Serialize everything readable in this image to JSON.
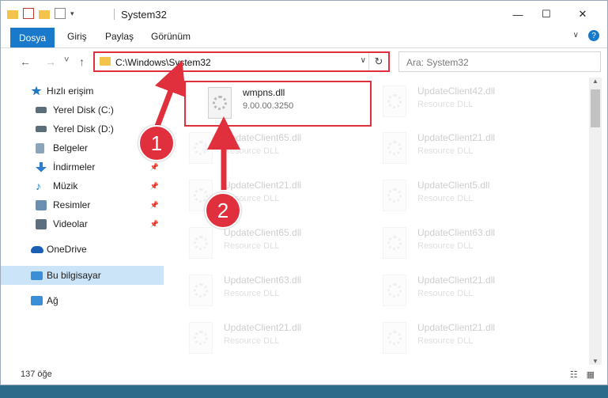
{
  "window": {
    "title": "System32",
    "minimize_glyph": "—",
    "maximize_glyph": "☐",
    "close_glyph": "✕"
  },
  "ribbon": {
    "tabs": [
      "Dosya",
      "Giriş",
      "Paylaş",
      "Görünüm"
    ]
  },
  "address_bar": {
    "path": "C:\\Windows\\System32",
    "refresh_glyph": "↻",
    "dropdown_glyph": "∨"
  },
  "search": {
    "placeholder": "Ara: System32"
  },
  "nav": {
    "back": "←",
    "forward": "→",
    "recent": "˅",
    "up": "↑"
  },
  "sidebar": {
    "items": [
      {
        "label": "Hızlı erişim",
        "icon": "star-icon",
        "color": "#1a78c2"
      },
      {
        "label": "Yerel Disk (C:)",
        "icon": "disk-icon",
        "color": "#5a6d7a"
      },
      {
        "label": "Yerel Disk (D:)",
        "icon": "disk-icon",
        "color": "#5a6d7a"
      },
      {
        "label": "Belgeler",
        "icon": "documents-icon",
        "color": "#8ca4ba"
      },
      {
        "label": "İndirmeler",
        "icon": "download-icon",
        "color": "#2f7fd0"
      },
      {
        "label": "Müzik",
        "icon": "music-icon",
        "color": "#1a78c2"
      },
      {
        "label": "Resimler",
        "icon": "pictures-icon",
        "color": "#6b8fb0"
      },
      {
        "label": "Videolar",
        "icon": "videos-icon",
        "color": "#5b6f80"
      },
      {
        "label": "OneDrive",
        "icon": "cloud-icon",
        "color": "#1a5fb4"
      },
      {
        "label": "Bu bilgisayar",
        "icon": "computer-icon",
        "color": "#3c8fd6"
      },
      {
        "label": "Ağ",
        "icon": "network-icon",
        "color": "#3c8fd6"
      }
    ]
  },
  "files": [
    {
      "name": "wmpns.dll",
      "type": "9.00.00.3250",
      "highlighted": true
    },
    {
      "name": "UpdateClient42.dll",
      "type": "Resource DLL"
    },
    {
      "name": "UpdateClient65.dll",
      "type": "Resource DLL"
    },
    {
      "name": "UpdateClient21.dll",
      "type": "Resource DLL"
    },
    {
      "name": "UpdateClient21.dll",
      "type": "Resource DLL"
    },
    {
      "name": "UpdateClient5.dll",
      "type": "Resource DLL"
    },
    {
      "name": "UpdateClient65.dll",
      "type": "Resource DLL"
    },
    {
      "name": "UpdateClient63.dll",
      "type": "Resource DLL"
    },
    {
      "name": "UpdateClient63.dll",
      "type": "Resource DLL"
    },
    {
      "name": "UpdateClient21.dll",
      "type": "Resource DLL"
    },
    {
      "name": "UpdateClient21.dll",
      "type": "Resource DLL"
    },
    {
      "name": "UpdateClient21.dll",
      "type": "Resource DLL"
    }
  ],
  "status": {
    "count": "137 öğe"
  },
  "annotations": {
    "step1": "1",
    "step2": "2",
    "color": "#e1303d"
  }
}
